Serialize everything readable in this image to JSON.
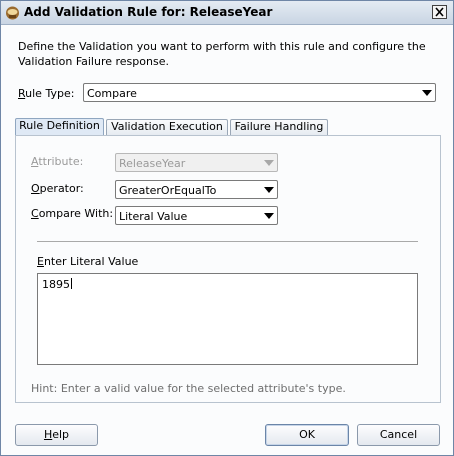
{
  "window": {
    "title": "Add Validation Rule for: ReleaseYear",
    "close_glyph": "close-icon"
  },
  "intro": "Define the Validation you want to perform with this rule and configure the Validation Failure response.",
  "rule_type": {
    "label_prefix": "",
    "label_mnemonic": "R",
    "label_rest": "ule Type:",
    "value": "Compare"
  },
  "tabs": [
    {
      "label": "Rule Definition",
      "active": true
    },
    {
      "label": "Validation Execution",
      "active": false
    },
    {
      "label": "Failure Handling",
      "active": false
    }
  ],
  "attribute": {
    "label_mnemonic": "A",
    "label_rest": "ttribute:",
    "value": "ReleaseYear"
  },
  "operator": {
    "label_mnemonic": "O",
    "label_rest": "perator:",
    "value": "GreaterOrEqualTo"
  },
  "compare_with": {
    "label_mnemonic": "C",
    "label_rest": "ompare With:",
    "value": "Literal Value"
  },
  "literal": {
    "label_mnemonic": "E",
    "label_rest": "nter Literal Value",
    "value": "1895"
  },
  "hint": "Hint: Enter a valid value for the selected attribute's type.",
  "buttons": {
    "help_mnemonic": "H",
    "help_rest": "elp",
    "ok": "OK",
    "cancel": "Cancel"
  }
}
